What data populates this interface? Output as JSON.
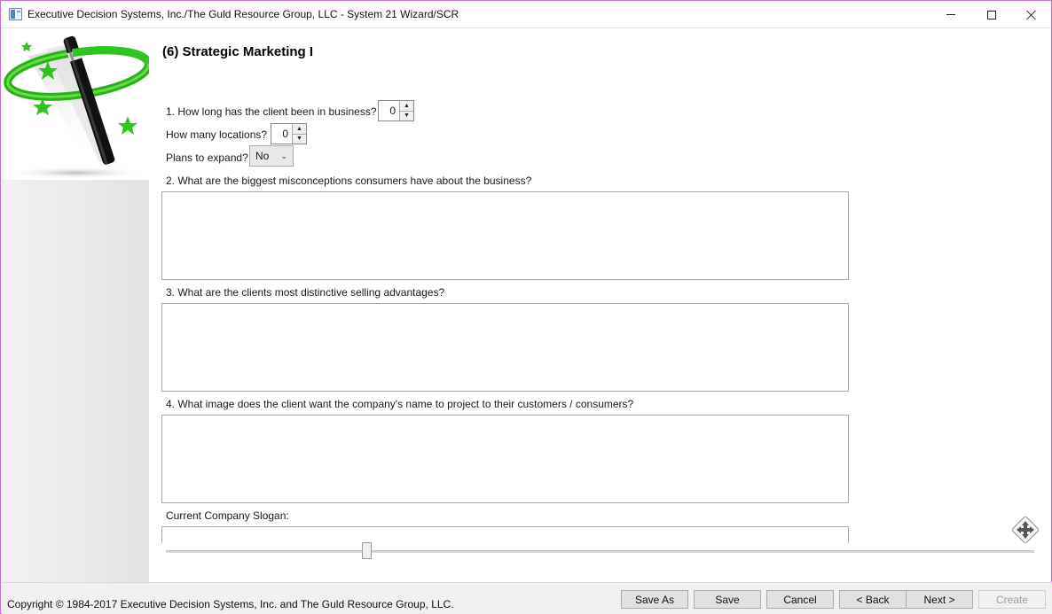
{
  "window": {
    "title": "Executive Decision Systems, Inc./The Guld Resource Group, LLC - System 21 Wizard/SCR"
  },
  "page": {
    "title": "(6) Strategic Marketing I"
  },
  "questions": {
    "years_in_business": {
      "label": "1. How long has the client been in business?",
      "value": "0"
    },
    "locations": {
      "label": "How many locations?",
      "value": "0"
    },
    "expand": {
      "label": "Plans to expand?",
      "value": "No"
    },
    "misconceptions": {
      "label": "2. What are the biggest misconceptions consumers have about the business?",
      "value": ""
    },
    "selling_advantages": {
      "label": "3. What are the clients most distinctive selling advantages?",
      "value": ""
    },
    "image": {
      "label": "4. What image does the client want the company's name to project to their customers / consumers?",
      "value": ""
    },
    "slogan": {
      "label": "Current Company Slogan:",
      "value": ""
    }
  },
  "icons": {
    "logo": "magic-wand-icon",
    "move": "move-arrows-icon",
    "spin_up": "chevron-up-icon",
    "spin_down": "chevron-down-icon",
    "dropdown": "chevron-down-icon"
  },
  "footer": {
    "copyright": "Copyright © 1984-2017 Executive Decision Systems, Inc. and The Guld Resource Group, LLC.",
    "buttons": {
      "save_as": "Save As",
      "save": "Save",
      "cancel": "Cancel",
      "back": "< Back",
      "next": "Next >",
      "create": "Create"
    }
  },
  "colors": {
    "window_border": "#c86dd7",
    "logo_green": "#2fc41f",
    "footer_bg": "#f0f0f0"
  }
}
